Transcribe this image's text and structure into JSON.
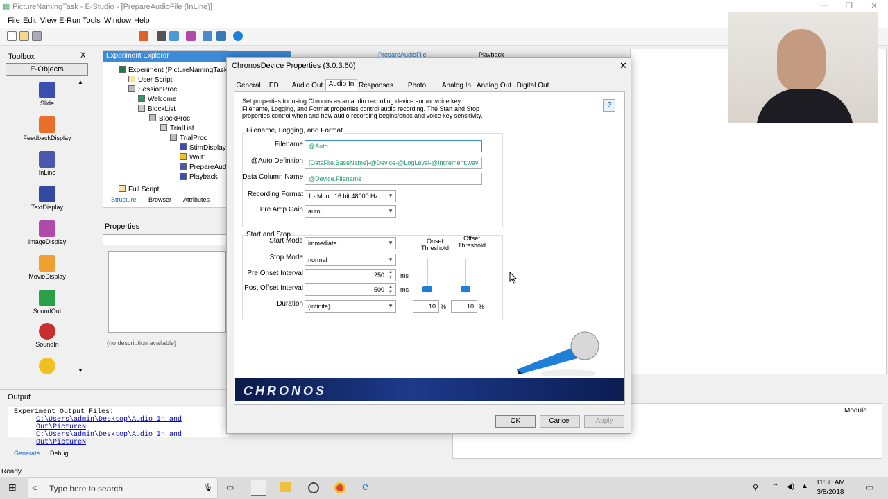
{
  "window": {
    "title": "PictureNamingTask - E-Studio - [PrepareAudioFile (InLine)]"
  },
  "menu": [
    "File",
    "Edit",
    "View",
    "E-Run",
    "Tools",
    "Window",
    "Help"
  ],
  "toolbox": {
    "title": "Toolbox",
    "close": "X",
    "category": "E-Objects",
    "items": [
      {
        "label": "Slide",
        "icon": "slide-icon",
        "color": "#3a4fb0"
      },
      {
        "label": "FeedbackDisplay",
        "icon": "feedback-icon",
        "color": "#e8702a"
      },
      {
        "label": "InLine",
        "icon": "inline-icon",
        "color": "#4a5aa8"
      },
      {
        "label": "TextDisplay",
        "icon": "text-icon",
        "color": "#334aa0"
      },
      {
        "label": "ImageDisplay",
        "icon": "image-icon",
        "color": "#b04aa8"
      },
      {
        "label": "MovieDisplay",
        "icon": "movie-icon",
        "color": "#f0a030"
      },
      {
        "label": "SoundOut",
        "icon": "speaker-icon",
        "color": "#2aa04a"
      },
      {
        "label": "SoundIn",
        "icon": "microphone-icon",
        "color": "#c83030"
      }
    ]
  },
  "explorer": {
    "title": "Experiment Explorer",
    "tree": [
      {
        "label": "Experiment (PictureNamingTask.e",
        "indent": 0
      },
      {
        "label": "User Script",
        "indent": 1
      },
      {
        "label": "SessionProc",
        "indent": 1
      },
      {
        "label": "Welcome",
        "indent": 2
      },
      {
        "label": "BlockList",
        "indent": 2
      },
      {
        "label": "BlockProc",
        "indent": 3
      },
      {
        "label": "TrialList",
        "indent": 4
      },
      {
        "label": "TrialProc",
        "indent": 5
      },
      {
        "label": "StimDisplay",
        "indent": 6
      },
      {
        "label": "Wait1",
        "indent": 6
      },
      {
        "label": "PrepareAud",
        "indent": 6
      },
      {
        "label": "Playback",
        "indent": 6
      },
      {
        "label": "Full Script",
        "indent": 0
      }
    ],
    "tabs": [
      "Structure",
      "Browser",
      "Attributes"
    ],
    "properties_title": "Properties",
    "no_description": "(no description available)"
  },
  "doc_tabs": [
    "PrepareAudioFile",
    "Playback"
  ],
  "dialog": {
    "title": "ChronosDevice Properties (3.0.3.60)",
    "tabs": [
      "General",
      "LED",
      "Audio Out",
      "Audio In",
      "Responses",
      "Photo Sensor",
      "Analog In",
      "Analog Out",
      "Digital Out"
    ],
    "active_tab": "Audio In",
    "description": "Set properties for using Chronos as an audio recording device and/or voice key. Filename, Logging, and Format properties control audio recording. The Start and Stop properties control when and how audio recording begins/ends and voice key sensitivity.",
    "group1": "Filename, Logging, and Format",
    "filename_label": "Filename",
    "filename_value": "@Auto",
    "autodef_label": "@Auto Definition",
    "autodef_value": "[DataFile.BaseName]-@Device-@LogLevel-@Increment.wav",
    "datacol_label": "Data Column Name",
    "datacol_value": "@Device.Filename",
    "recformat_label": "Recording Format",
    "recformat_value": "1 - Mono 16 bit 48000 Hz",
    "preamp_label": "Pre Amp Gain",
    "preamp_value": "auto",
    "group2": "Start and Stop",
    "startmode_label": "Start Mode",
    "startmode_value": "immediate",
    "stopmode_label": "Stop Mode",
    "stopmode_value": "normal",
    "preonset_label": "Pre Onset Interval",
    "preonset_value": "250",
    "postoffset_label": "Post Offset Interval",
    "postoffset_value": "500",
    "ms": "ms",
    "duration_label": "Duration",
    "duration_value": "(infinite)",
    "onset_label": "Onset Threshold",
    "offset_label": "Offset Threshold",
    "onset_value": "10",
    "offset_value": "10",
    "pct": "%",
    "brand": "CHRONOS",
    "buttons": {
      "ok": "OK",
      "cancel": "Cancel",
      "apply": "Apply"
    }
  },
  "output": {
    "title": "Output",
    "text": "Experiment Output Files:",
    "links": [
      "C:\\Users\\admin\\Desktop\\Audio In and Out\\PictureN",
      "C:\\Users\\admin\\Desktop\\Audio In and Out\\PictureN"
    ],
    "tabs": [
      "Generate",
      "Debug"
    ],
    "module_header": "Module"
  },
  "status": "Ready",
  "taskbar": {
    "search_placeholder": "Type here to search",
    "time": "11:30 AM",
    "date": "3/8/2018"
  }
}
